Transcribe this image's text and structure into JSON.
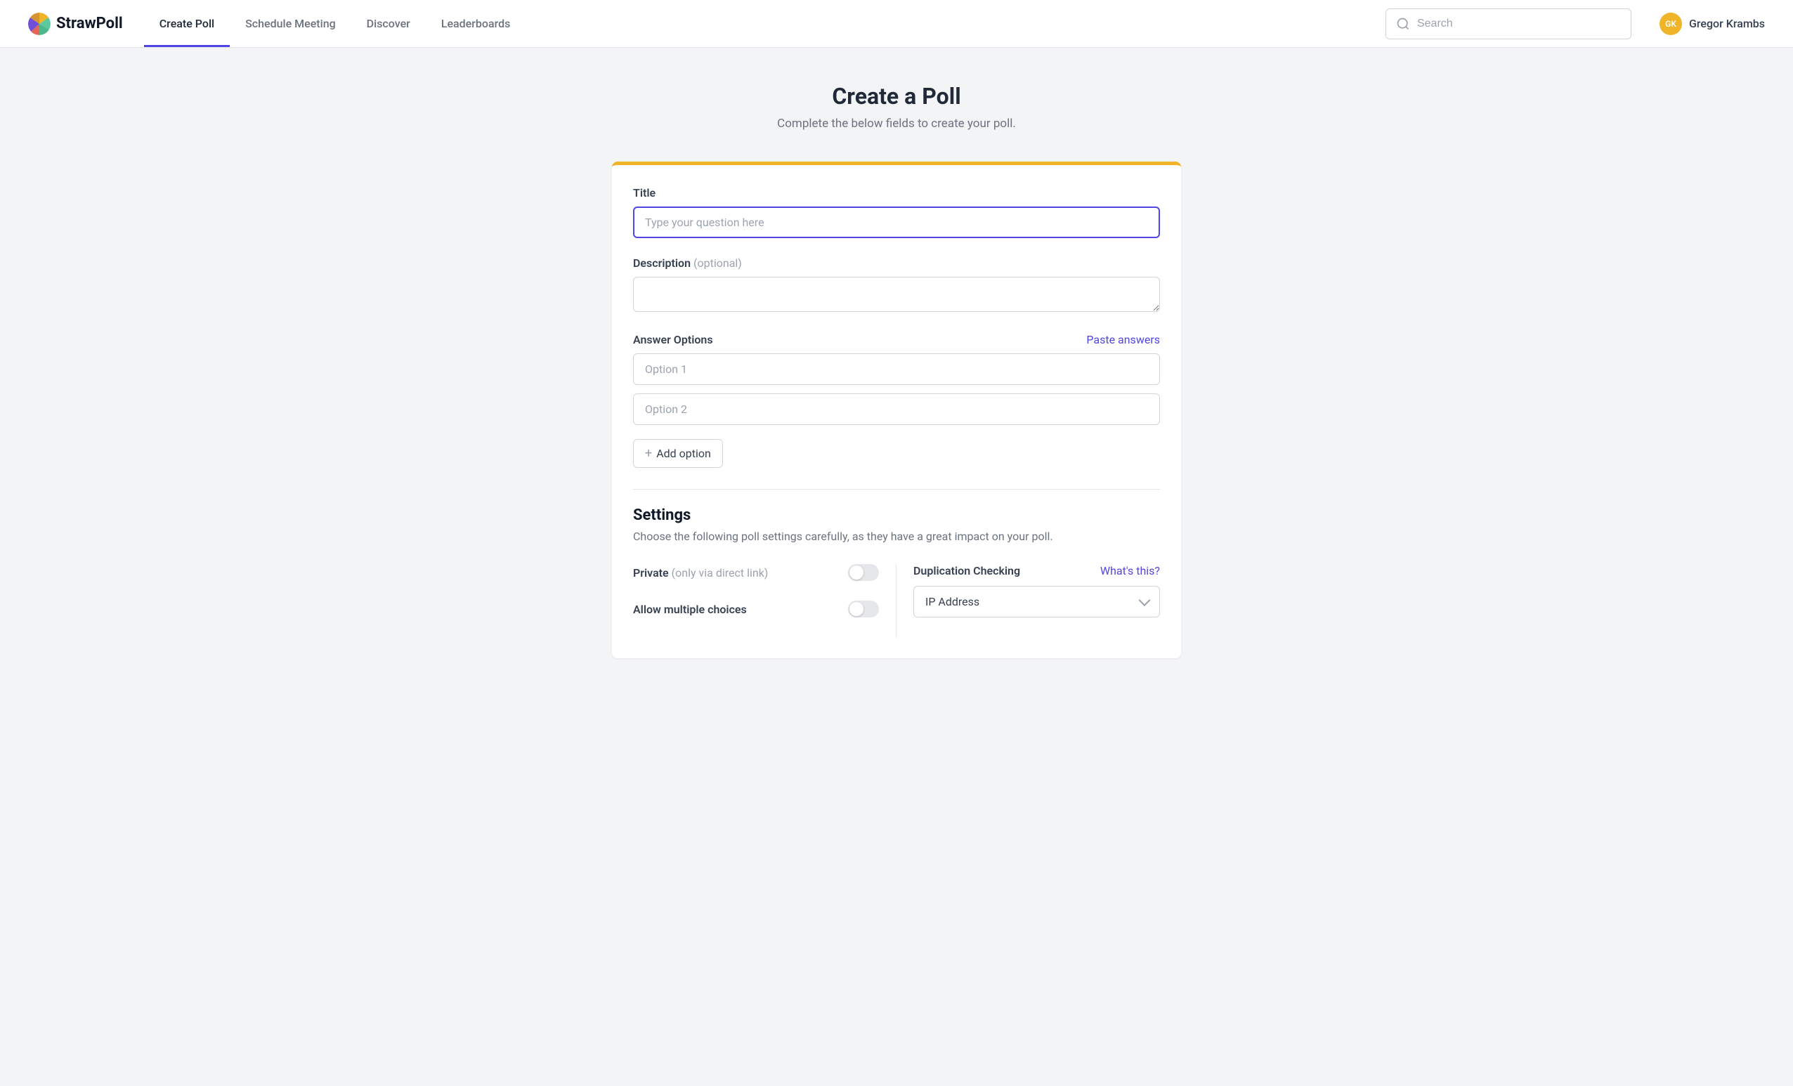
{
  "brand": {
    "name": "StrawPoll"
  },
  "nav": {
    "items": [
      {
        "label": "Create Poll",
        "active": true
      },
      {
        "label": "Schedule Meeting",
        "active": false
      },
      {
        "label": "Discover",
        "active": false
      },
      {
        "label": "Leaderboards",
        "active": false
      }
    ]
  },
  "search": {
    "placeholder": "Search"
  },
  "user": {
    "initials": "GK",
    "name": "Gregor Krambs"
  },
  "page": {
    "title": "Create a Poll",
    "subtitle": "Complete the below fields to create your poll."
  },
  "form": {
    "title": {
      "label": "Title",
      "placeholder": "Type your question here",
      "value": ""
    },
    "description": {
      "label": "Description ",
      "optional": "(optional)",
      "value": ""
    },
    "options": {
      "label": "Answer Options",
      "paste_link": "Paste answers",
      "items": [
        {
          "placeholder": "Option 1"
        },
        {
          "placeholder": "Option 2"
        }
      ],
      "add_button": "Add option"
    }
  },
  "settings": {
    "title": "Settings",
    "subtitle": "Choose the following poll settings carefully, as they have a great impact on your poll.",
    "private": {
      "label": "Private ",
      "hint": "(only via direct link)"
    },
    "multiple": {
      "label": "Allow multiple choices"
    },
    "duplication": {
      "label": "Duplication Checking",
      "whats_this": "What's this?",
      "selected": "IP Address"
    }
  },
  "colors": {
    "accent": "#5145e5",
    "gold": "#f0b429"
  }
}
